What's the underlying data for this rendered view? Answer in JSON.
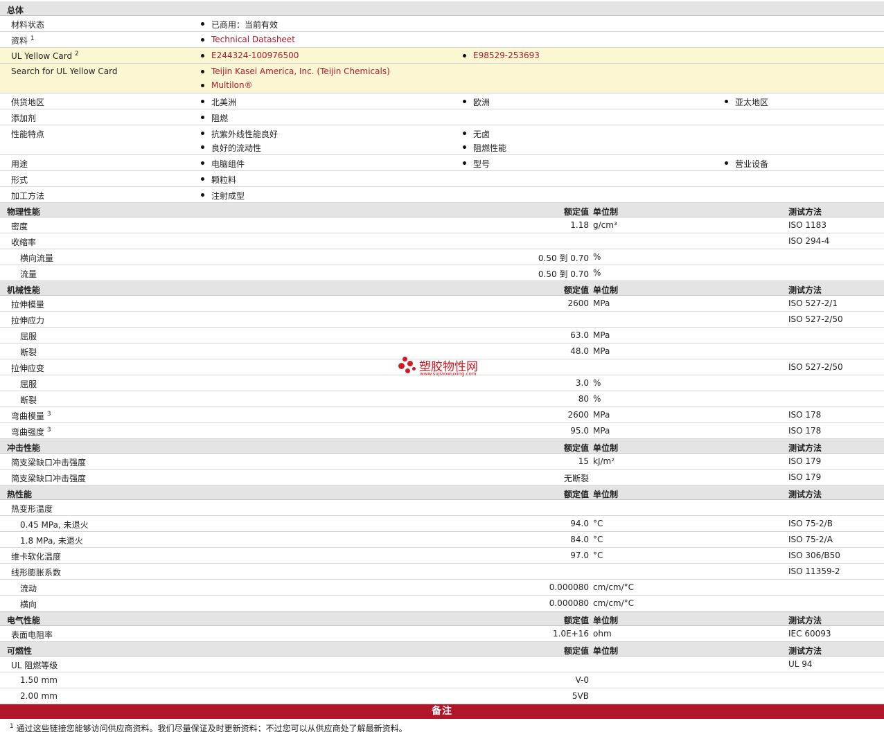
{
  "general": {
    "title": "总体",
    "rows": [
      {
        "label": "材料状态",
        "sup": "",
        "cols": [
          [
            "已商用：当前有效"
          ]
        ],
        "yellow": false,
        "link": false
      },
      {
        "label": "资料",
        "sup": "1",
        "cols": [
          [
            "Technical Datasheet"
          ]
        ],
        "yellow": false,
        "link": true
      },
      {
        "label": "UL Yellow Card",
        "sup": "2",
        "cols": [
          [
            "E244324-100976500"
          ],
          [
            "E98529-253693"
          ]
        ],
        "yellow": true,
        "link": true
      },
      {
        "label": "Search for UL Yellow Card",
        "sup": "",
        "cols": [
          [
            "Teijin Kasei America, Inc. (Teijin Chemicals)",
            "Multilon®"
          ]
        ],
        "yellow": true,
        "link": true
      },
      {
        "label": "供货地区",
        "sup": "",
        "cols": [
          [
            "北美洲"
          ],
          [
            "欧洲"
          ],
          [
            "亚太地区"
          ]
        ],
        "yellow": false,
        "link": false
      },
      {
        "label": "添加剂",
        "sup": "",
        "cols": [
          [
            "阻燃"
          ]
        ],
        "yellow": false,
        "link": false
      },
      {
        "label": "性能特点",
        "sup": "",
        "cols": [
          [
            "抗紫外线性能良好",
            "良好的流动性"
          ],
          [
            "无卤",
            "阻燃性能"
          ]
        ],
        "yellow": false,
        "link": false
      },
      {
        "label": "用途",
        "sup": "",
        "cols": [
          [
            "电脑组件"
          ],
          [
            "型号"
          ],
          [
            "营业设备"
          ]
        ],
        "yellow": false,
        "link": false
      },
      {
        "label": "形式",
        "sup": "",
        "cols": [
          [
            "颗粒料"
          ]
        ],
        "yellow": false,
        "link": false
      },
      {
        "label": "加工方法",
        "sup": "",
        "cols": [
          [
            "注射成型"
          ]
        ],
        "yellow": false,
        "link": false
      }
    ]
  },
  "column_headers": {
    "value": "额定值",
    "unit": "单位制",
    "method": "测试方法"
  },
  "sections": [
    {
      "title": "物理性能",
      "rows": [
        {
          "label": "密度",
          "sup": "",
          "sub": false,
          "value": "1.18",
          "unit": "g/cm³",
          "method": "ISO 1183"
        },
        {
          "label": "收缩率",
          "sup": "",
          "sub": false,
          "value": "",
          "unit": "",
          "method": "ISO 294-4"
        },
        {
          "label": "横向流量",
          "sup": "",
          "sub": true,
          "value": "0.50 到  0.70",
          "unit": "%",
          "method": ""
        },
        {
          "label": "流量",
          "sup": "",
          "sub": true,
          "value": "0.50 到  0.70",
          "unit": "%",
          "method": ""
        }
      ]
    },
    {
      "title": "机械性能",
      "rows": [
        {
          "label": "拉伸模量",
          "sup": "",
          "sub": false,
          "value": "2600",
          "unit": "MPa",
          "method": "ISO 527-2/1"
        },
        {
          "label": "拉伸应力",
          "sup": "",
          "sub": false,
          "value": "",
          "unit": "",
          "method": "ISO 527-2/50"
        },
        {
          "label": "屈服",
          "sup": "",
          "sub": true,
          "value": "63.0",
          "unit": "MPa",
          "method": ""
        },
        {
          "label": "断裂",
          "sup": "",
          "sub": true,
          "value": "48.0",
          "unit": "MPa",
          "method": ""
        },
        {
          "label": "拉伸应变",
          "sup": "",
          "sub": false,
          "value": "",
          "unit": "",
          "method": "ISO 527-2/50"
        },
        {
          "label": "屈服",
          "sup": "",
          "sub": true,
          "value": "3.0",
          "unit": "%",
          "method": ""
        },
        {
          "label": "断裂",
          "sup": "",
          "sub": true,
          "value": "80",
          "unit": "%",
          "method": ""
        },
        {
          "label": "弯曲模量",
          "sup": "3",
          "sub": false,
          "value": "2600",
          "unit": "MPa",
          "method": "ISO 178"
        },
        {
          "label": "弯曲强度",
          "sup": "3",
          "sub": false,
          "value": "95.0",
          "unit": "MPa",
          "method": "ISO 178"
        }
      ]
    },
    {
      "title": "冲击性能",
      "rows": [
        {
          "label": "简支梁缺口冲击强度",
          "sup": "",
          "sub": false,
          "value": "15",
          "unit": "kJ/m²",
          "method": "ISO 179"
        },
        {
          "label": "简支梁缺口冲击强度",
          "sup": "",
          "sub": false,
          "value": "无断裂",
          "unit": "",
          "method": "ISO 179"
        }
      ]
    },
    {
      "title": "热性能",
      "rows": [
        {
          "label": "热变形温度",
          "sup": "",
          "sub": false,
          "value": "",
          "unit": "",
          "method": ""
        },
        {
          "label": "0.45 MPa, 未退火",
          "sup": "",
          "sub": true,
          "value": "94.0",
          "unit": "°C",
          "method": "ISO 75-2/B"
        },
        {
          "label": "1.8 MPa, 未退火",
          "sup": "",
          "sub": true,
          "value": "84.0",
          "unit": "°C",
          "method": "ISO 75-2/A"
        },
        {
          "label": "维卡软化温度",
          "sup": "",
          "sub": false,
          "value": "97.0",
          "unit": "°C",
          "method": "ISO 306/B50"
        },
        {
          "label": "线形膨胀系数",
          "sup": "",
          "sub": false,
          "value": "",
          "unit": "",
          "method": "ISO 11359-2"
        },
        {
          "label": "流动",
          "sup": "",
          "sub": true,
          "value": "0.000080",
          "unit": "cm/cm/°C",
          "method": ""
        },
        {
          "label": "横向",
          "sup": "",
          "sub": true,
          "value": "0.000080",
          "unit": "cm/cm/°C",
          "method": ""
        }
      ]
    },
    {
      "title": "电气性能",
      "rows": [
        {
          "label": "表面电阻率",
          "sup": "",
          "sub": false,
          "value": "1.0E+16",
          "unit": "ohm",
          "method": "IEC 60093"
        }
      ]
    },
    {
      "title": "可燃性",
      "rows": [
        {
          "label": "UL 阻燃等级",
          "sup": "",
          "sub": false,
          "value": "",
          "unit": "",
          "method": "UL 94"
        },
        {
          "label": "1.50 mm",
          "sup": "",
          "sub": true,
          "value": "V-0",
          "unit": "",
          "method": ""
        },
        {
          "label": "2.00 mm",
          "sup": "",
          "sub": true,
          "value": "5VB",
          "unit": "",
          "method": ""
        }
      ]
    }
  ],
  "notes": {
    "title": "备注",
    "footnote_mark": "1",
    "footnote": "通过这些链接您能够访问供应商资料。我们尽量保证及时更新资料；不过您可以从供应商处了解最新资料。"
  },
  "watermark": {
    "text": "塑胶物性网",
    "url": "www.sujiaowuxing.com",
    "color": "#d21a22"
  },
  "colors": {
    "link": "#b0182b",
    "header_bg": "#e4e4e4",
    "highlight_bg": "#fbf7d2",
    "notes_bar": "#b0152a"
  }
}
